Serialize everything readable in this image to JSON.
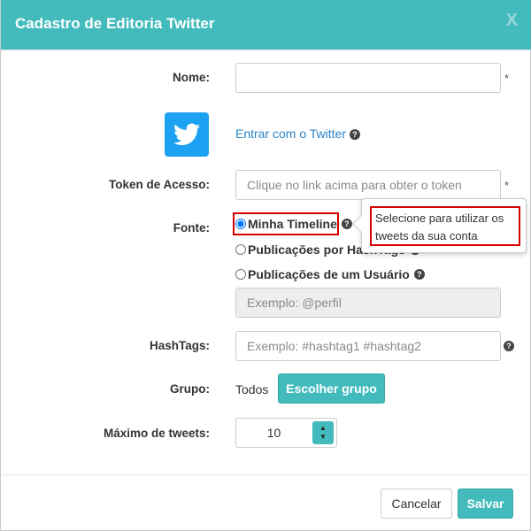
{
  "modal": {
    "title": "Cadastro de Editoria Twitter",
    "close_label": "X"
  },
  "form": {
    "nome": {
      "label": "Nome:",
      "value": "",
      "placeholder": "",
      "required_mark": "*"
    },
    "twitter_link": {
      "text": "Entrar com o Twitter",
      "help": "?"
    },
    "token": {
      "label": "Token de Acesso:",
      "placeholder": "Clique no link acima para obter o token",
      "required_mark": "*"
    },
    "fonte": {
      "label": "Fonte:",
      "options": [
        {
          "label": "Minha Timeline",
          "selected": true,
          "help": "?"
        },
        {
          "label": "Publicações por HashTags",
          "selected": false,
          "help": "?"
        },
        {
          "label": "Publicações de um Usuário",
          "selected": false,
          "help": "?"
        }
      ],
      "perfil_placeholder": "Exemplo: @perfil"
    },
    "tooltip": {
      "text": "Selecione para utilizar os tweets da sua conta"
    },
    "hashtags": {
      "label": "HashTags:",
      "placeholder": "Exemplo: #hashtag1 #hashtag2",
      "help": "?"
    },
    "grupo": {
      "label": "Grupo:",
      "value": "Todos",
      "button_label": "Escolher grupo"
    },
    "maximo": {
      "label": "Máximo de tweets:",
      "value": "10",
      "up": "▲",
      "down": "▼"
    }
  },
  "footer": {
    "cancel_label": "Cancelar",
    "save_label": "Salvar"
  },
  "colors": {
    "accent": "#43bbbc",
    "twitter": "#1da1f2",
    "link": "#2a84c6",
    "highlight": "#d50000"
  },
  "icons": {
    "twitter_logo": "twitter-bird-icon",
    "help": "question-circle-icon",
    "close": "close-icon"
  }
}
